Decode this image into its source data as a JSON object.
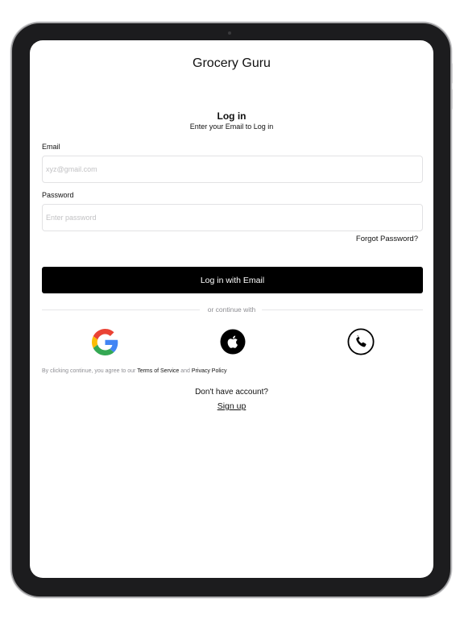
{
  "app": {
    "title": "Grocery Guru"
  },
  "login": {
    "heading": "Log in",
    "subheading": "Enter your Email to Log in"
  },
  "form": {
    "email_label": "Email",
    "email_placeholder": "xyz@gmail.com",
    "email_value": "",
    "password_label": "Password",
    "password_placeholder": "Enter password",
    "password_value": "",
    "forgot_label": "Forgot Password?",
    "submit_label": "Log in with Email"
  },
  "divider": {
    "text": "or continue with"
  },
  "social": [
    {
      "icon": "google-icon"
    },
    {
      "icon": "apple-icon"
    },
    {
      "icon": "phone-icon"
    }
  ],
  "terms": {
    "prefix": "By clicking continue, you agree to our",
    "terms_link": "Terms of Service",
    "and": "and",
    "privacy_link": "Privacy Policy"
  },
  "signup": {
    "prompt": "Don't have account?",
    "link_label": "Sign up"
  },
  "colors": {
    "primary_button": "#000000",
    "primary_button_text": "#ffffff",
    "device_bezel": "#1c1c1e",
    "muted_text": "#8e8e93",
    "google_blue": "#4285F4",
    "google_red": "#EA4335",
    "google_yellow": "#FBBC05",
    "google_green": "#34A853"
  }
}
